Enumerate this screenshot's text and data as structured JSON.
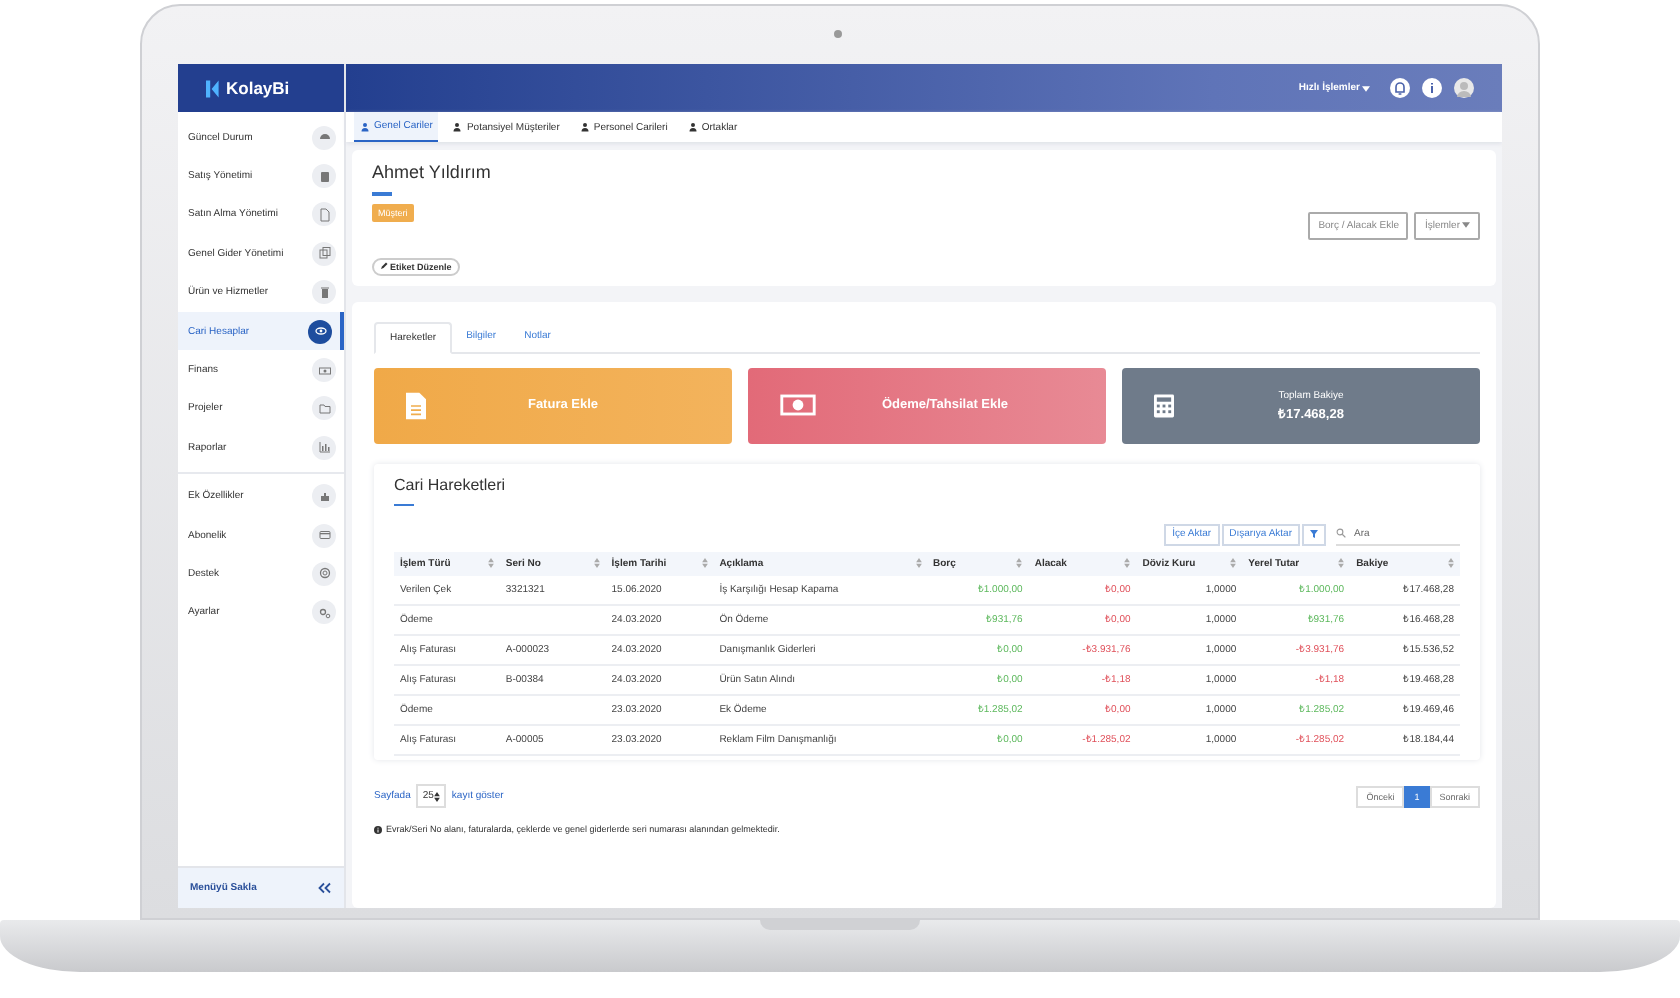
{
  "app": {
    "logo": "KolayBi",
    "quick_actions": "Hızlı İşlemler"
  },
  "sidebar": {
    "groups": [
      [
        {
          "label": "Güncel Durum",
          "selected": false
        },
        {
          "label": "Satış Yönetimi",
          "selected": false
        },
        {
          "label": "Satın Alma Yönetimi",
          "selected": false
        },
        {
          "label": "Genel Gider Yönetimi",
          "selected": false
        },
        {
          "label": "Ürün ve Hizmetler",
          "selected": false
        },
        {
          "label": "Cari Hesaplar",
          "selected": true
        },
        {
          "label": "Finans",
          "selected": false
        },
        {
          "label": "Projeler",
          "selected": false
        },
        {
          "label": "Raporlar",
          "selected": false
        }
      ],
      [
        {
          "label": "Ek Özellikler",
          "selected": false
        },
        {
          "label": "Abonelik",
          "selected": false
        },
        {
          "label": "Destek",
          "selected": false
        },
        {
          "label": "Ayarlar",
          "selected": false
        }
      ]
    ],
    "hide_label": "Menüyü Sakla"
  },
  "tabs": [
    {
      "label": "Genel Cariler",
      "selected": true
    },
    {
      "label": "Potansiyel Müşteriler",
      "selected": false
    },
    {
      "label": "Personel Carileri",
      "selected": false
    },
    {
      "label": "Ortaklar",
      "selected": false
    }
  ],
  "customer": {
    "name": "Ahmet Yıldırım",
    "tag": "Müşteri",
    "edit_tag": "Etiket Düzenle",
    "actions": [
      "Borç / Alacak Ekle",
      "İşlemler"
    ]
  },
  "sub_tabs": [
    {
      "label": "Hareketler",
      "selected": true
    },
    {
      "label": "Bilgiler",
      "selected": false
    },
    {
      "label": "Notlar",
      "selected": false
    }
  ],
  "cards": [
    {
      "kind": "invoice",
      "label": "Fatura Ekle"
    },
    {
      "kind": "payment",
      "label": "Ödeme/Tahsilat Ekle"
    },
    {
      "kind": "balance",
      "label": "Toplam Bakiye",
      "value": "₺17.468,28"
    }
  ],
  "movements": {
    "title": "Cari Hareketleri",
    "toolbar": [
      "İçe Aktar",
      "Dışarıya Aktar"
    ],
    "search_placeholder": "Ara",
    "columns": [
      {
        "label": "İşlem Türü",
        "kind": "text"
      },
      {
        "label": "Seri No",
        "kind": "text"
      },
      {
        "label": "İşlem Tarihi",
        "kind": "text"
      },
      {
        "label": "Açıklama",
        "kind": "text"
      },
      {
        "label": "Borç",
        "kind": "debit"
      },
      {
        "label": "Alacak",
        "kind": "credit"
      },
      {
        "label": "Döviz Kuru",
        "kind": "number"
      },
      {
        "label": "Yerel Tutar",
        "kind": "local"
      },
      {
        "label": "Bakiye",
        "kind": "number"
      }
    ],
    "rows": [
      {
        "cells": [
          "Verilen Çek",
          "3321321",
          "15.06.2020",
          "İş Karşılığı Hesap Kapama",
          "₺1.000,00",
          "₺0,00",
          "1,0000",
          "₺1.000,00",
          "₺17.468,28"
        ],
        "kind": "income"
      },
      {
        "cells": [
          "Ödeme",
          "",
          "24.03.2020",
          "Ön Ödeme",
          "₺931,76",
          "₺0,00",
          "1,0000",
          "₺931,76",
          "₺16.468,28"
        ],
        "kind": "income"
      },
      {
        "cells": [
          "Alış Faturası",
          "A-000023",
          "24.03.2020",
          "Danışmanlık Giderleri",
          "₺0,00",
          "-₺3.931,76",
          "1,0000",
          "-₺3.931,76",
          "₺15.536,52"
        ],
        "kind": "expense"
      },
      {
        "cells": [
          "Alış Faturası",
          "B-00384",
          "24.03.2020",
          "Ürün Satın Alındı",
          "₺0,00",
          "-₺1,18",
          "1,0000",
          "-₺1,18",
          "₺19.468,28"
        ],
        "kind": "expense"
      },
      {
        "cells": [
          "Ödeme",
          "",
          "23.03.2020",
          "Ek Ödeme",
          "₺1.285,02",
          "₺0,00",
          "1,0000",
          "₺1.285,02",
          "₺19.469,46"
        ],
        "kind": "income"
      },
      {
        "cells": [
          "Alış Faturası",
          "A-00005",
          "23.03.2020",
          "Reklam Film Danışmanlığı",
          "₺0,00",
          "-₺1.285,02",
          "1,0000",
          "-₺1.285,02",
          "₺18.184,44"
        ],
        "kind": "expense"
      }
    ]
  },
  "footer": {
    "page_label": "Sayfada",
    "page_size": "25",
    "page_suffix": "kayıt göster",
    "pager": [
      {
        "label": "Önceki",
        "selected": false
      },
      {
        "label": "1",
        "selected": true
      },
      {
        "label": "Sonraki",
        "selected": false
      }
    ],
    "note": "Evrak/Seri No alanı, faturalarda, çeklerde ve genel giderlerde seri numarası alanından gelmektedir."
  }
}
